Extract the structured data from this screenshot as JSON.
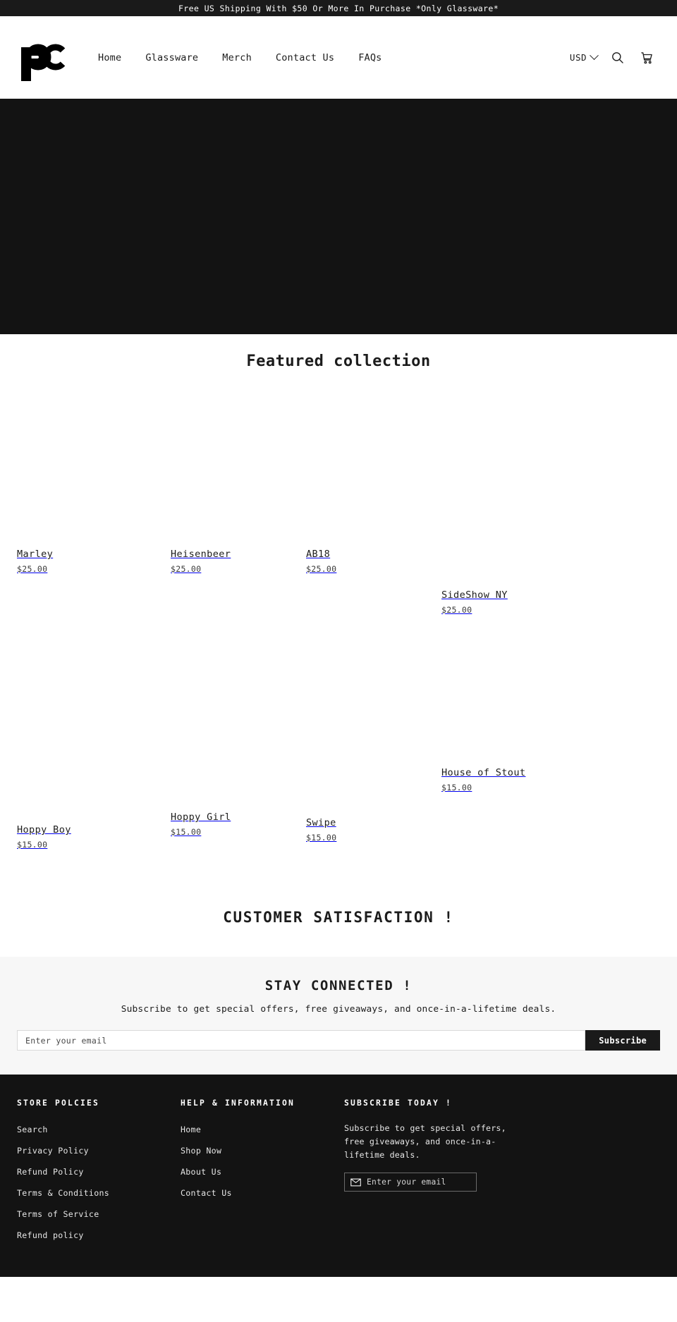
{
  "announcement": {
    "text": "Free US Shipping With $50 Or More In Purchase *Only Glassware*"
  },
  "header": {
    "logo_alt": "pc",
    "nav": [
      {
        "label": "Home"
      },
      {
        "label": "Glassware"
      },
      {
        "label": "Merch"
      },
      {
        "label": "Contact Us"
      },
      {
        "label": "FAQs"
      }
    ],
    "currency": "USD",
    "search_icon": "search-icon",
    "cart_icon": "cart-icon",
    "chevron_icon": "chevron-down-icon"
  },
  "featured": {
    "title": "Featured collection",
    "products": [
      {
        "name": "Marley",
        "price": "$25.00"
      },
      {
        "name": "Heisenbeer",
        "price": "$25.00"
      },
      {
        "name": "AB18",
        "price": "$25.00"
      },
      {
        "name": "SideShow NY",
        "price": "$25.00"
      },
      {
        "name": "Hoppy Boy",
        "price": "$15.00"
      },
      {
        "name": "Hoppy Girl",
        "price": "$15.00"
      },
      {
        "name": "Swipe",
        "price": "$15.00"
      },
      {
        "name": "House of Stout",
        "price": "$15.00"
      }
    ]
  },
  "satisfaction": {
    "heading": "CUSTOMER SATISFACTION !"
  },
  "newsletter": {
    "title": "STAY CONNECTED !",
    "subtitle": "Subscribe to get special offers, free giveaways, and once-in-a-lifetime deals.",
    "placeholder": "Enter your email",
    "button": "Subscribe"
  },
  "footer": {
    "col1": {
      "heading": "STORE POLCIES",
      "links": [
        {
          "label": "Search"
        },
        {
          "label": "Privacy Policy"
        },
        {
          "label": "Refund Policy"
        },
        {
          "label": "Terms & Conditions"
        },
        {
          "label": "Terms of Service"
        },
        {
          "label": "Refund policy"
        }
      ]
    },
    "col2": {
      "heading": "HELP & INFORMATION",
      "links": [
        {
          "label": "Home"
        },
        {
          "label": "Shop Now"
        },
        {
          "label": "About Us"
        },
        {
          "label": "Contact Us"
        }
      ]
    },
    "col3": {
      "heading": "SUBSCRIBE TODAY !",
      "text": "Subscribe to get special offers, free giveaways, and once-in-a-lifetime deals.",
      "placeholder": "Enter your email",
      "mail_icon": "envelope-icon"
    }
  },
  "colors": {
    "dark": "#131313",
    "announce_bg": "#1a1a1a",
    "newsletter_bg": "#f7f7f7",
    "text": "#1c1c1c"
  }
}
